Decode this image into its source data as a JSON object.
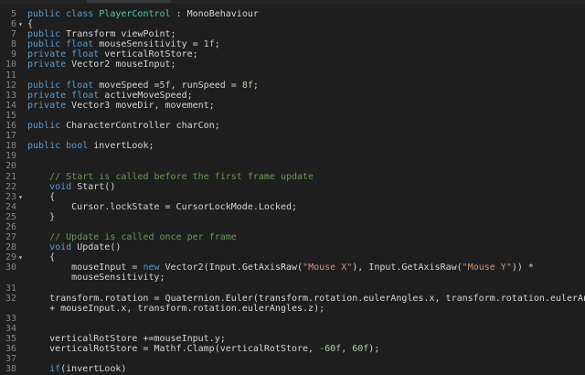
{
  "editor": {
    "colors": {
      "background": "#1e1e1e",
      "keyword": "#569cd6",
      "type": "#4ec9b0",
      "comment": "#6a9955",
      "string": "#ce9178",
      "number": "#b5cea8",
      "text": "#d4d4d4",
      "line_number": "#858585"
    },
    "lines": [
      {
        "num": "5",
        "fold": "",
        "segments": [
          [
            "kw",
            "public "
          ],
          [
            "kw",
            "class "
          ],
          [
            "ty",
            "PlayerControl"
          ],
          [
            "id",
            " : "
          ],
          [
            "id",
            "MonoBehaviour"
          ]
        ]
      },
      {
        "num": "6",
        "fold": "▾",
        "segments": [
          [
            "id",
            "{"
          ]
        ]
      },
      {
        "num": "7",
        "fold": "",
        "segments": [
          [
            "kw",
            "public "
          ],
          [
            "id",
            "Transform viewPoint;"
          ]
        ]
      },
      {
        "num": "8",
        "fold": "",
        "segments": [
          [
            "kw",
            "public "
          ],
          [
            "kw",
            "float "
          ],
          [
            "id",
            "mouseSensitivity = "
          ],
          [
            "nu",
            "1f"
          ],
          [
            "id",
            ";"
          ]
        ]
      },
      {
        "num": "9",
        "fold": "",
        "segments": [
          [
            "kw",
            "private "
          ],
          [
            "kw",
            "float "
          ],
          [
            "id",
            "verticalRotStore;"
          ]
        ]
      },
      {
        "num": "10",
        "fold": "",
        "segments": [
          [
            "kw",
            "private "
          ],
          [
            "id",
            "Vector2 mouseInput;"
          ]
        ]
      },
      {
        "num": "11",
        "fold": "",
        "segments": []
      },
      {
        "num": "12",
        "fold": "",
        "segments": [
          [
            "kw",
            "public "
          ],
          [
            "kw",
            "float "
          ],
          [
            "id",
            "moveSpeed ="
          ],
          [
            "nu",
            "5f"
          ],
          [
            "id",
            ", runSpeed = "
          ],
          [
            "nu",
            "8f"
          ],
          [
            "id",
            ";"
          ]
        ]
      },
      {
        "num": "13",
        "fold": "",
        "segments": [
          [
            "kw",
            "private "
          ],
          [
            "kw",
            "float "
          ],
          [
            "id",
            "activeMoveSpeed;"
          ]
        ]
      },
      {
        "num": "14",
        "fold": "",
        "segments": [
          [
            "kw",
            "private "
          ],
          [
            "id",
            "Vector3 moveDir, movement;"
          ]
        ]
      },
      {
        "num": "15",
        "fold": "",
        "segments": []
      },
      {
        "num": "16",
        "fold": "",
        "segments": [
          [
            "kw",
            "public "
          ],
          [
            "id",
            "CharacterController charCon;"
          ]
        ]
      },
      {
        "num": "17",
        "fold": "",
        "segments": []
      },
      {
        "num": "18",
        "fold": "",
        "segments": [
          [
            "kw",
            "public "
          ],
          [
            "kw",
            "bool "
          ],
          [
            "id",
            "invertLook;"
          ]
        ]
      },
      {
        "num": "19",
        "fold": "",
        "segments": []
      },
      {
        "num": "20",
        "fold": "",
        "segments": []
      },
      {
        "num": "21",
        "fold": "",
        "segments": [
          [
            "id",
            "    "
          ],
          [
            "cm",
            "// Start is called before the first frame update"
          ]
        ]
      },
      {
        "num": "22",
        "fold": "",
        "segments": [
          [
            "id",
            "    "
          ],
          [
            "kw",
            "void "
          ],
          [
            "id",
            "Start()"
          ]
        ]
      },
      {
        "num": "23",
        "fold": "▾",
        "segments": [
          [
            "id",
            "    {"
          ]
        ]
      },
      {
        "num": "24",
        "fold": "",
        "segments": [
          [
            "id",
            "        Cursor.lockState = CursorLockMode.Locked;"
          ]
        ]
      },
      {
        "num": "25",
        "fold": "",
        "segments": [
          [
            "id",
            "    }"
          ]
        ]
      },
      {
        "num": "26",
        "fold": "",
        "segments": []
      },
      {
        "num": "27",
        "fold": "",
        "segments": [
          [
            "id",
            "    "
          ],
          [
            "cm",
            "// Update is called once per frame"
          ]
        ]
      },
      {
        "num": "28",
        "fold": "",
        "segments": [
          [
            "id",
            "    "
          ],
          [
            "kw",
            "void "
          ],
          [
            "id",
            "Update()"
          ]
        ]
      },
      {
        "num": "29",
        "fold": "▾",
        "segments": [
          [
            "id",
            "    {"
          ]
        ]
      },
      {
        "num": "30",
        "fold": "",
        "segments": [
          [
            "id",
            "        mouseInput = "
          ],
          [
            "kw",
            "new "
          ],
          [
            "id",
            "Vector2(Input.GetAxisRaw("
          ],
          [
            "st",
            "\"Mouse X\""
          ],
          [
            "id",
            "), Input.GetAxisRaw("
          ],
          [
            "st",
            "\"Mouse Y\""
          ],
          [
            "id",
            ")) *"
          ]
        ]
      },
      {
        "num": "",
        "fold": "",
        "segments": [
          [
            "id",
            "        mouseSensitivity;"
          ]
        ]
      },
      {
        "num": "31",
        "fold": "",
        "segments": []
      },
      {
        "num": "32",
        "fold": "",
        "segments": [
          [
            "id",
            "    transform.rotation = Quaternion.Euler(transform.rotation.eulerAngles.x, transform.rotation.eulerAngles.y"
          ]
        ]
      },
      {
        "num": "",
        "fold": "",
        "segments": [
          [
            "id",
            "    + mouseInput.x, transform.rotation.eulerAngles.z);"
          ]
        ]
      },
      {
        "num": "33",
        "fold": "",
        "segments": []
      },
      {
        "num": "34",
        "fold": "",
        "segments": []
      },
      {
        "num": "35",
        "fold": "",
        "segments": [
          [
            "id",
            "    verticalRotStore +=mouseInput.y;"
          ]
        ]
      },
      {
        "num": "36",
        "fold": "",
        "segments": [
          [
            "id",
            "    verticalRotStore = Mathf.Clamp(verticalRotStore, "
          ],
          [
            "nu",
            "-60f"
          ],
          [
            "id",
            ", "
          ],
          [
            "nu",
            "60f"
          ],
          [
            "id",
            ");"
          ]
        ]
      },
      {
        "num": "37",
        "fold": "",
        "segments": []
      },
      {
        "num": "38",
        "fold": "",
        "segments": [
          [
            "id",
            "    "
          ],
          [
            "kw",
            "if"
          ],
          [
            "id",
            "(invertLook)"
          ]
        ]
      }
    ]
  }
}
